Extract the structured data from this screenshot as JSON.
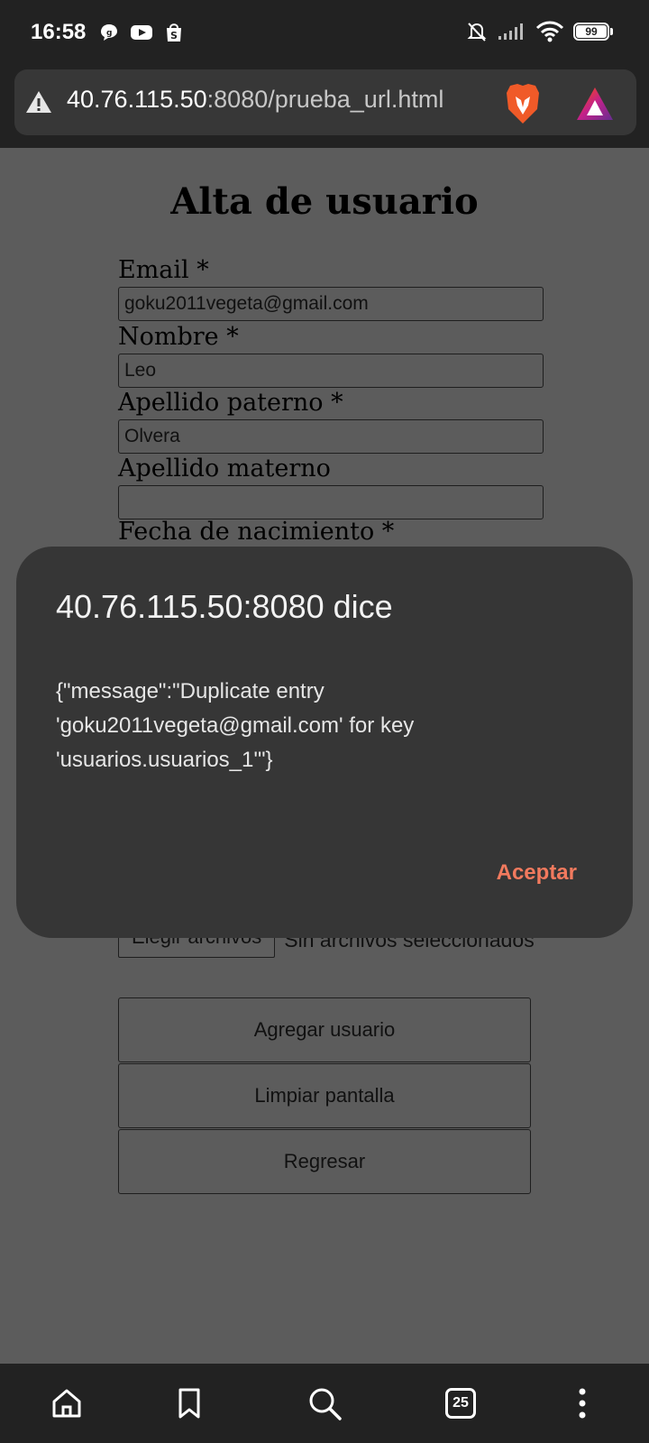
{
  "status_bar": {
    "time": "16:58",
    "app_icons": [
      "chat-bubble-icon",
      "youtube-icon",
      "shopping-bag-icon"
    ],
    "battery_level": "99",
    "indicators": [
      "bell-muted-icon",
      "signal-icon",
      "wifi-icon"
    ]
  },
  "browser": {
    "url_host": "40.76.115.50",
    "url_rest": ":8080/prueba_url.html",
    "security_icon": "warning-icon",
    "shield_icon": "brave-lion-icon",
    "rewards_icon": "brave-rewards-icon"
  },
  "form": {
    "title": "Alta de usuario",
    "fields": [
      {
        "label": "Email *",
        "value": "goku2011vegeta@gmail.com"
      },
      {
        "label": "Nombre *",
        "value": "Leo"
      },
      {
        "label": "Apellido paterno *",
        "value": "Olvera"
      },
      {
        "label": "Apellido materno",
        "value": ""
      },
      {
        "label": "Fecha de nacimiento *",
        "value": ""
      }
    ],
    "file_button": "Elegir archivos",
    "file_status": "Sin archivos seleccionados",
    "buttons": {
      "add": "Agregar usuario",
      "clear": "Limpiar pantalla",
      "back": "Regresar"
    }
  },
  "dialog": {
    "title": "40.76.115.50:8080 dice",
    "message": "{\"message\":\"Duplicate entry 'goku2011vegeta@gmail.com' for key 'usuarios.usuarios_1'\"}",
    "ok_label": "Aceptar"
  },
  "bottom_nav": {
    "tab_count": "25",
    "items": [
      "home-icon",
      "bookmark-icon",
      "search-icon",
      "tabs-icon",
      "more-icon"
    ]
  },
  "colors": {
    "dialog_accent": "#f27a5e",
    "page_background": "#5c5c5c",
    "chrome_background": "#222222"
  }
}
